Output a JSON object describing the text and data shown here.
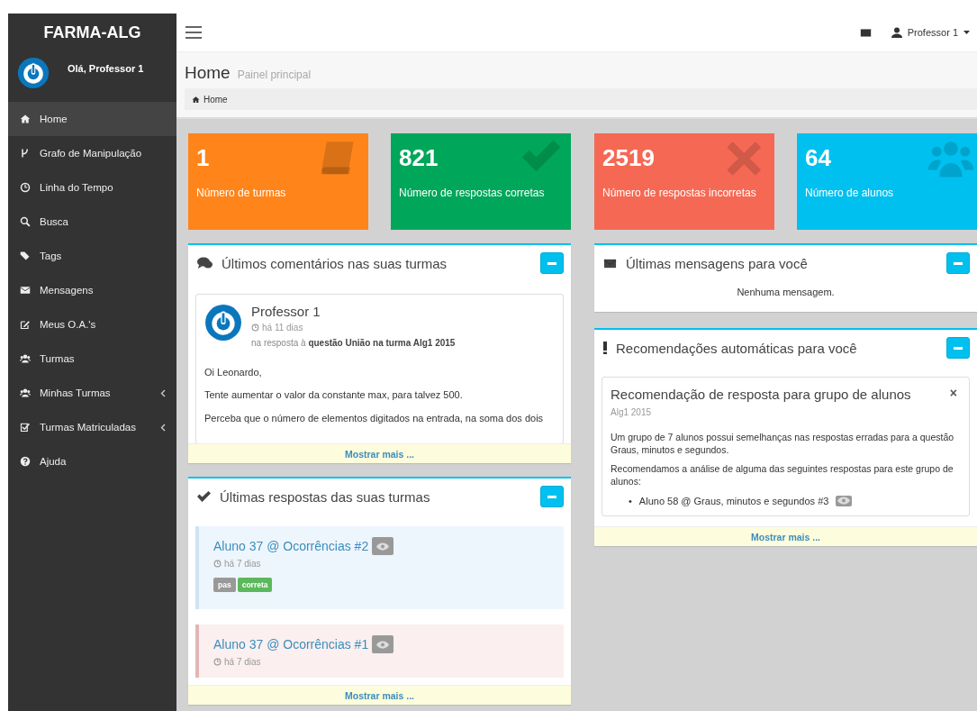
{
  "brand": "FARMA-ALG",
  "user_greeting": "Olá, Professor 1",
  "sidebar": {
    "items": [
      {
        "label": "Home",
        "selected": true,
        "submenu": false
      },
      {
        "label": "Grafo de Manipulação",
        "selected": false,
        "submenu": false
      },
      {
        "label": "Linha do Tempo",
        "selected": false,
        "submenu": false
      },
      {
        "label": "Busca",
        "selected": false,
        "submenu": false
      },
      {
        "label": "Tags",
        "selected": false,
        "submenu": false
      },
      {
        "label": "Mensagens",
        "selected": false,
        "submenu": false
      },
      {
        "label": "Meus O.A.'s",
        "selected": false,
        "submenu": false
      },
      {
        "label": "Turmas",
        "selected": false,
        "submenu": false
      },
      {
        "label": "Minhas Turmas",
        "selected": false,
        "submenu": true
      },
      {
        "label": "Turmas Matriculadas",
        "selected": false,
        "submenu": true
      },
      {
        "label": "Ajuda",
        "selected": false,
        "submenu": false
      }
    ]
  },
  "topbar": {
    "user_menu": "Professor 1"
  },
  "header": {
    "title": "Home",
    "subtitle": "Painel principal",
    "breadcrumb": "Home"
  },
  "stats": [
    {
      "value": "1",
      "label": "Número de turmas",
      "color": "#ff851b"
    },
    {
      "value": "821",
      "label": "Número de respostas corretas",
      "color": "#00a65a"
    },
    {
      "value": "2519",
      "label": "Número de respostas incorretas",
      "color": "#f56954"
    },
    {
      "value": "64",
      "label": "Número de alunos",
      "color": "#00c0ef"
    }
  ],
  "comments_panel": {
    "title": "Últimos comentários nas suas turmas",
    "author": "Professor 1",
    "time": "há 11 dias",
    "context": "na resposta à **questão União na turma Alg1 2015**",
    "paragraphs": [
      "Oi Leonardo,",
      "Tente aumentar o valor da constante max, para talvez 500.",
      "Perceba que o número de elementos digitados na entrada, na soma dos dois"
    ],
    "more": "Mostrar mais ..."
  },
  "answers_panel": {
    "title": "Últimas respostas das suas turmas",
    "items": [
      {
        "title": "Aluno 37 @ Ocorrências #2",
        "time": "há 7 dias",
        "correct": true,
        "tags": [
          {
            "label": "pas",
            "color": "#999999"
          },
          {
            "label": "correta",
            "color": "#5cb85c"
          }
        ]
      },
      {
        "title": "Aluno 37 @ Ocorrências #1",
        "time": "há 7 dias",
        "correct": false
      }
    ],
    "more": "Mostrar mais ..."
  },
  "messages_panel": {
    "title": "Últimas mensagens para você",
    "empty": "Nenhuma mensagem."
  },
  "recommendations_panel": {
    "title": "Recomendações automáticas para você",
    "card_title": "Recomendação de resposta para grupo de alunos",
    "close": "×",
    "course": "Alg1 2015",
    "paragraphs": [
      "Um grupo de 7 alunos possui semelhanças nas respostas erradas para a questão Graus, minutos e segundos.",
      "Recomendamos a análise de alguma das seguintes respostas para este grupo de alunos:"
    ],
    "answers": [
      {
        "bullet": "•",
        "text": "Aluno 58 @ Graus, minutos e segundos #3"
      }
    ],
    "more": "Mostrar mais ..."
  }
}
